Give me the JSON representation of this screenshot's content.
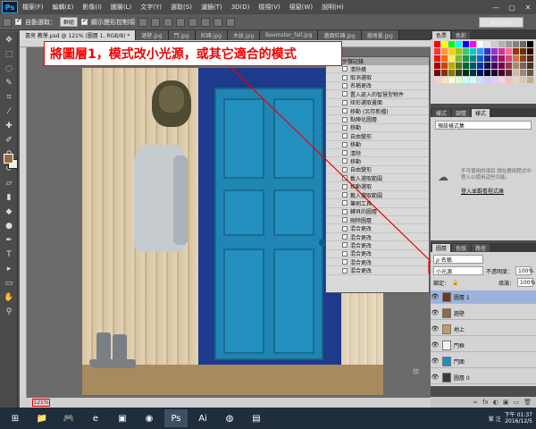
{
  "menubar": {
    "logo": "Ps",
    "items": [
      "檔案(F)",
      "編輯(E)",
      "影像(I)",
      "圖層(L)",
      "文字(Y)",
      "選取(S)",
      "濾鏡(T)",
      "3D(D)",
      "檢視(V)",
      "視窗(W)",
      "說明(H)"
    ],
    "window_controls": [
      "—",
      "▢",
      "✕"
    ]
  },
  "optionsbar": {
    "auto_select_label": "自動選取：",
    "auto_select_value": "群組",
    "show_transform_label": "顯示變形控制項",
    "workspace": "基本功能"
  },
  "doc_tabs": [
    "書房 教學.psd @ 121% (圖層 1, RGB/8) *",
    "牆壁.jpg",
    "門.jpg",
    "紅磚.jpg",
    "木紋.jpg",
    "Beemster_fall.jpg",
    "牆面紅磚.jpg",
    "牆堵畫.jpg"
  ],
  "annotation": "將圖層1，模式改小光源，或其它適合的模式",
  "history": {
    "title": "步驟記錄",
    "items": [
      "清除橫",
      "取消選取",
      "名稱更改",
      "置入嵌入的智慧型物件",
      "矩形選取畫面",
      "移動 (另存新檔)",
      "點陣化圖層",
      "移動",
      "自由變形",
      "移動",
      "清除",
      "移動",
      "自由變形",
      "載入選取範圍",
      "移動選取",
      "載入選取範圍",
      "筆刷工具",
      "轉貝的圖層",
      "刪除圖層",
      "混合更改",
      "混合更改",
      "混合更改",
      "混合更改",
      "混合更改",
      "混合更改"
    ]
  },
  "swatches_panel": {
    "tabs": [
      "色票",
      "色彩"
    ],
    "colors": [
      "#ff0000",
      "#ffff00",
      "#00ff00",
      "#00ffff",
      "#0000ff",
      "#ff00ff",
      "#ffffff",
      "#e6e6e6",
      "#cccccc",
      "#b3b3b3",
      "#999999",
      "#808080",
      "#666666",
      "#000000",
      "#ff3333",
      "#ff9933",
      "#ffcc00",
      "#99cc00",
      "#33cc66",
      "#00cccc",
      "#3399ff",
      "#3333cc",
      "#9933cc",
      "#cc3399",
      "#ff6699",
      "#993300",
      "#663300",
      "#330000",
      "#ee1111",
      "#ff6600",
      "#ffee55",
      "#77bb33",
      "#119944",
      "#008888",
      "#0066cc",
      "#222288",
      "#662299",
      "#aa1166",
      "#dd4477",
      "#cc7744",
      "#884422",
      "#552211",
      "#aa0000",
      "#cc4400",
      "#bbaa00",
      "#557722",
      "#006633",
      "#005566",
      "#003399",
      "#111155",
      "#440066",
      "#770044",
      "#993355",
      "#aa8866",
      "#776655",
      "#443322",
      "#770000",
      "#883300",
      "#887700",
      "#334411",
      "#003311",
      "#003344",
      "#001166",
      "#000033",
      "#220033",
      "#440022",
      "#662233",
      "#ccbbaa",
      "#998877",
      "#665544",
      "#ffcccc",
      "#ffe0c0",
      "#ffffcc",
      "#ddffcc",
      "#ccffee",
      "#ccffff",
      "#cce0ff",
      "#ccccff",
      "#e0ccff",
      "#ffccf0",
      "#f0c0c0",
      "#e8d8c0",
      "#d8c8b0",
      "#c0b090"
    ]
  },
  "styles_panel": {
    "tabs": [
      "樣式",
      "調整",
      "樣式"
    ],
    "select": "預設樣式集",
    "message": "不可使用的項目 請在應用程式中登入以使用這些功能。",
    "link": "登入並觀看程式庫"
  },
  "layers_panel": {
    "tabs": [
      "圖層",
      "色版",
      "路徑"
    ],
    "kind_filter": "ρ 名稱",
    "blend_mode": "小光源",
    "opacity_label": "不透明度：",
    "opacity_value": "100%",
    "lock_label": "鎖定：",
    "fill_label": "填滿：",
    "fill_value": "100%",
    "layers": [
      {
        "name": "圖層 1",
        "selected": true,
        "thumb": "#6b3b20"
      },
      {
        "name": "牆壁",
        "selected": false,
        "thumb": "#8a6a45"
      },
      {
        "name": "地上",
        "selected": false,
        "thumb": "#c59a5e"
      },
      {
        "name": "門框",
        "selected": false,
        "thumb": "#f2f2f2"
      },
      {
        "name": "門面",
        "selected": false,
        "thumb": "#1a8fc4"
      },
      {
        "name": "圖層 0",
        "selected": false,
        "thumb": "#3a3a3a"
      }
    ],
    "footer_icons": [
      "∞",
      "fx",
      "◐",
      "▣",
      "▭",
      "🗑"
    ]
  },
  "statusbar": {
    "zoom": "121%"
  },
  "taskbar": {
    "apps": [
      "⊞",
      "📁",
      "🎮",
      "e",
      "▣",
      "◉",
      "Ps",
      "Ai",
      "◍",
      "▤"
    ],
    "tray_text": "繁 注",
    "time": "下午 01:37",
    "date": "2016/12/5"
  },
  "watermark": [
    "欣",
    "繁 注"
  ]
}
